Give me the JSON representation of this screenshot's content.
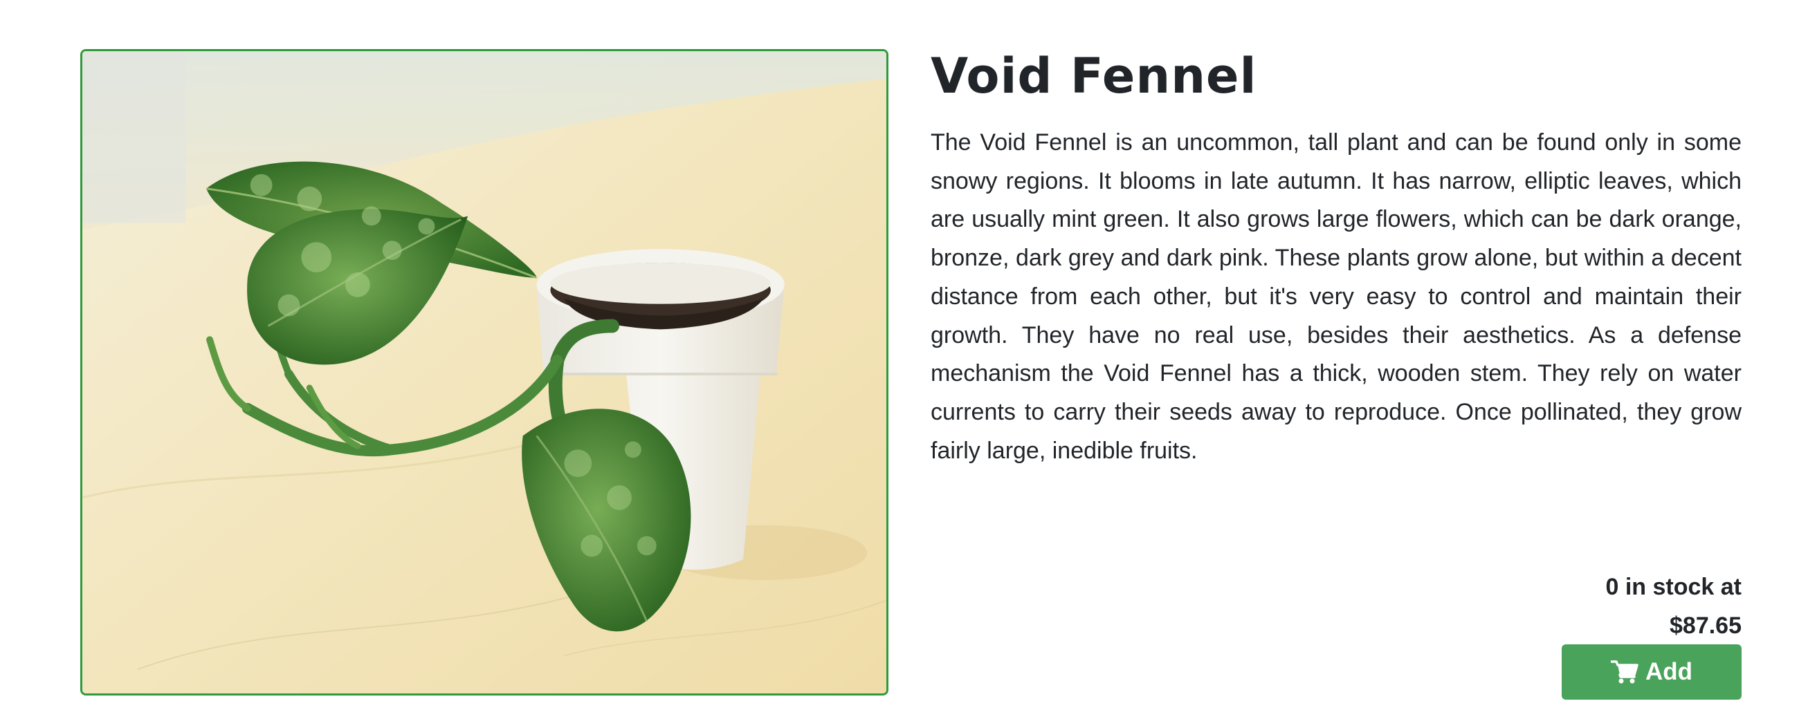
{
  "product": {
    "image_alt": "Potted plant with green variegated leaves",
    "name": "Void Fennel",
    "description": "The Void Fennel is an uncommon, tall plant and can be found only in some snowy regions. It blooms in late autumn. It has narrow, elliptic leaves, which are usually mint green. It also grows large flowers, which can be dark orange, bronze, dark grey and dark pink. These plants grow alone, but within a decent distance from each other, but it's very easy to control and maintain their growth. They have no real use, besides their aesthetics. As a defense mechanism the Void Fennel has a thick, wooden stem. They rely on water currents to carry their seeds away to reproduce. Once pollinated, they grow fairly large, inedible fruits.",
    "stock_line": "0 in stock at",
    "price": "$87.65",
    "add_label": "Add",
    "cart_icon": "shopping-cart-icon"
  },
  "colors": {
    "frame_border": "#2e9a3c",
    "button_bg": "#4aa35a",
    "button_text": "#ffffff",
    "text": "#212529"
  }
}
